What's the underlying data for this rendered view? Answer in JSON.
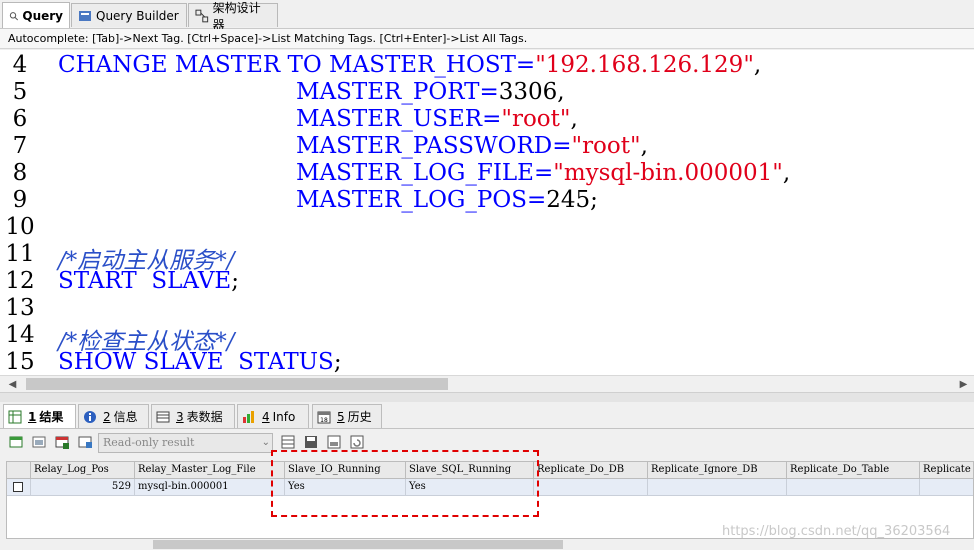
{
  "top_tabs": [
    {
      "label": "Query",
      "icon": "query-icon",
      "active": true
    },
    {
      "label": "Query Builder",
      "icon": "query-builder-icon",
      "active": false
    },
    {
      "label": "架构设计器",
      "icon": "schema-designer-icon",
      "active": false
    }
  ],
  "autocomplete_hint": "Autocomplete: [Tab]->Next Tag. [Ctrl+Space]->List Matching Tags. [Ctrl+Enter]->List All Tags.",
  "editor": {
    "line_numbers": [
      "4",
      "5",
      "6",
      "7",
      "8",
      "9",
      "10",
      "11",
      "12",
      "13",
      "14",
      "15"
    ],
    "lines": {
      "l4_kw": "CHANGE MASTER TO MASTER_HOST=",
      "l4_str": "\"192.168.126.129\"",
      "l4_pun": ",",
      "l5_kw": "MASTER_PORT=",
      "l5_num": "3306",
      "l5_pun": ",",
      "l6_kw": "MASTER_USER=",
      "l6_str": "\"root\"",
      "l6_pun": ",",
      "l7_kw": "MASTER_PASSWORD=",
      "l7_str": "\"root\"",
      "l7_pun": ",",
      "l8_kw": "MASTER_LOG_FILE=",
      "l8_str": "\"mysql-bin.000001\"",
      "l8_pun": ",",
      "l9_kw": "MASTER_LOG_POS=",
      "l9_num": "245",
      "l9_pun": ";",
      "l11_cmt": "/*启动主从服务*/",
      "l12_kw": "START  SLAVE",
      "l12_pun": ";",
      "l14_cmt": "/*检查主从状态*/",
      "l15_kw": "SHOW SLAVE  STATUS",
      "l15_pun": ";"
    }
  },
  "result_tabs": [
    {
      "num": "1",
      "label": "结果",
      "icon": "result-grid-icon",
      "active": true
    },
    {
      "num": "2",
      "label": "信息",
      "icon": "info-icon",
      "active": false
    },
    {
      "num": "3",
      "label": "表数据",
      "icon": "table-data-icon",
      "active": false
    },
    {
      "num": "4",
      "label": "Info",
      "icon": "info-chart-icon",
      "active": false
    },
    {
      "num": "5",
      "label": "历史",
      "icon": "history-icon",
      "active": false
    }
  ],
  "toolbar": {
    "readonly_select": "Read-only result"
  },
  "grid": {
    "columns": [
      "Relay_Log_Pos",
      "Relay_Master_Log_File",
      "Slave_IO_Running",
      "Slave_SQL_Running",
      "Replicate_Do_DB",
      "Replicate_Ignore_DB",
      "Replicate_Do_Table",
      "Replicate"
    ],
    "row": [
      "529",
      "mysql-bin.000001",
      "Yes",
      "Yes",
      "",
      "",
      "",
      ""
    ]
  },
  "colors": {
    "keyword": "#0000ff",
    "string": "#e0001a",
    "comment": "#2a4fc8",
    "highlight": "#e00000"
  },
  "watermark": "https://blog.csdn.net/qq_36203564"
}
